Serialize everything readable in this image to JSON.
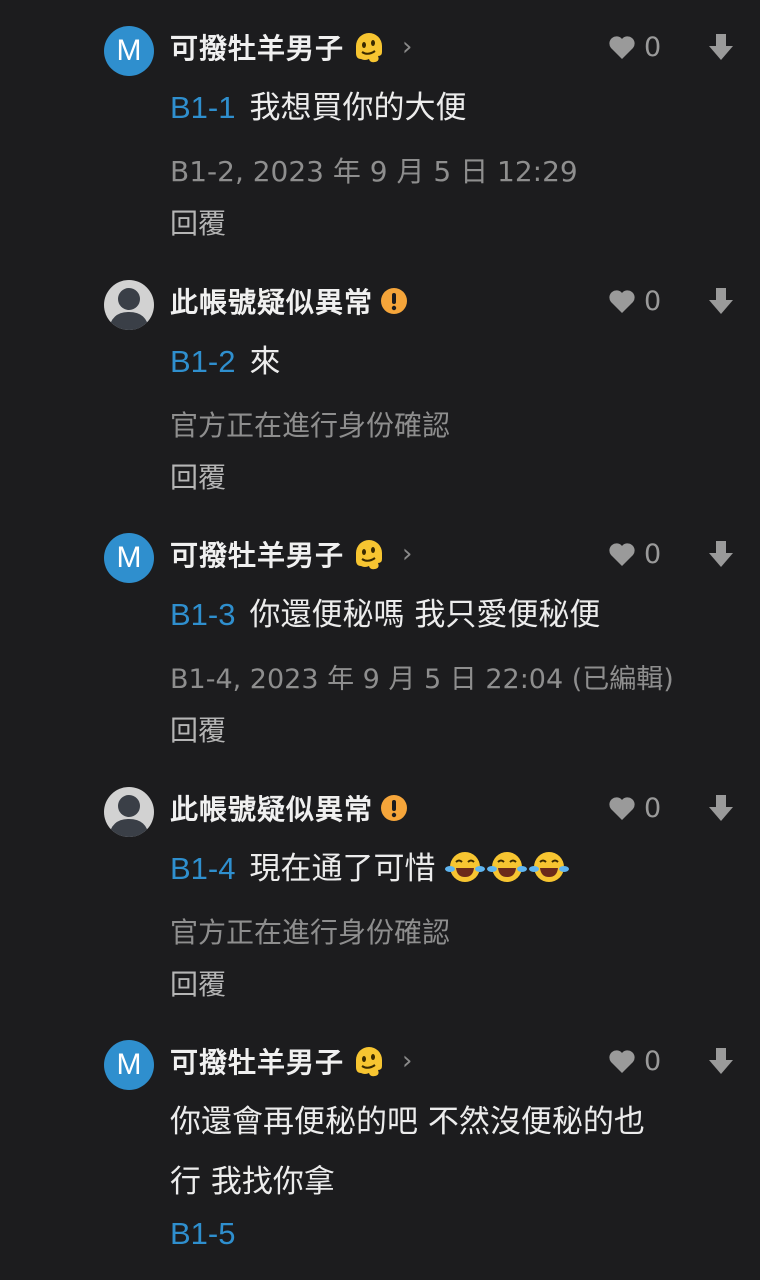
{
  "comments": [
    {
      "author": "可撥牡羊男子",
      "avatar_letter": "M",
      "badge_icon": "melting-face-emoji",
      "floor": "B1-1",
      "text": "我想買你的大便",
      "meta": "B1-2, 2023 年 9 月 5 日 12:29",
      "reply_label": "回覆",
      "likes": "0"
    },
    {
      "author": "此帳號疑似異常",
      "avatar_letter": "",
      "badge_icon": "warning-icon",
      "floor": "B1-2",
      "text": "來",
      "meta": "官方正在進行身份確認",
      "reply_label": "回覆",
      "likes": "0"
    },
    {
      "author": "可撥牡羊男子",
      "avatar_letter": "M",
      "badge_icon": "melting-face-emoji",
      "floor": "B1-3",
      "text": "你還便秘嗎 我只愛便秘便",
      "meta": "B1-4, 2023 年 9 月 5 日 22:04 (已編輯)",
      "reply_label": "回覆",
      "likes": "0"
    },
    {
      "author": "此帳號疑似異常",
      "avatar_letter": "",
      "badge_icon": "warning-icon",
      "floor": "B1-4",
      "text": "現在通了可惜",
      "emojis": [
        "tears-of-joy-emoji",
        "tears-of-joy-emoji",
        "tears-of-joy-emoji"
      ],
      "meta": "官方正在進行身份確認",
      "reply_label": "回覆",
      "likes": "0"
    },
    {
      "author": "可撥牡羊男子",
      "avatar_letter": "M",
      "badge_icon": "melting-face-emoji",
      "text_line1": "你還會再便秘的吧 不然沒便秘的也",
      "text_line2": "行 我找你拿",
      "floor": "B1-5",
      "likes": "0"
    }
  ],
  "colors": {
    "background": "#1c1c1e",
    "floor_link": "#2f8fce",
    "avatar_m": "#2f8fce",
    "warning": "#f5a53a",
    "muted": "#8e8e8e"
  }
}
